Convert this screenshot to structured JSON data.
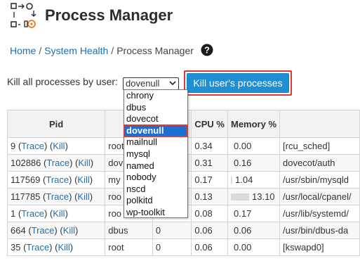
{
  "header": {
    "title": "Process Manager",
    "icon": "process-manager-icon"
  },
  "breadcrumb": {
    "home": "Home",
    "sep": "/",
    "system_health": "System Health",
    "current": "Process Manager",
    "help_icon": "question-circle-icon"
  },
  "kill": {
    "label": "Kill all processes by user:",
    "selected_user": "dovenull",
    "button_label": "Kill user's processes",
    "options": [
      "chrony",
      "dbus",
      "dovecot",
      "dovenull",
      "mailnull",
      "mysql",
      "named",
      "nobody",
      "nscd",
      "polkitd",
      "wp-toolkit"
    ]
  },
  "table": {
    "headers": {
      "pid": "Pid",
      "owner": "O",
      "priority": "ity",
      "cpu": "CPU %",
      "memory": "Memory %",
      "command": ""
    },
    "trace_label": "Trace",
    "kill_label": "Kill",
    "rows": [
      {
        "pid": "9",
        "owner": "root",
        "priority": "",
        "cpu": "0.34",
        "memory": "0.00",
        "mem_fraction": 0.0,
        "command": "[rcu_sched]"
      },
      {
        "pid": "102886",
        "owner": "dov",
        "priority": "",
        "cpu": "0.31",
        "memory": "0.16",
        "mem_fraction": 0.0,
        "command": "dovecot/auth"
      },
      {
        "pid": "117569",
        "owner": "my",
        "priority": "",
        "cpu": "0.17",
        "memory": "1.04",
        "mem_fraction": 0.01,
        "command": "/usr/sbin/mysqld"
      },
      {
        "pid": "117785",
        "owner": "roo",
        "priority": "",
        "cpu": "0.13",
        "memory": "13.10",
        "mem_fraction": 0.131,
        "command": "/usr/local/cpanel/"
      },
      {
        "pid": "1",
        "owner": "roo",
        "priority": "",
        "cpu": "0.08",
        "memory": "0.17",
        "mem_fraction": 0.0,
        "command": "/usr/lib/systemd/"
      },
      {
        "pid": "664",
        "owner": "dbus",
        "priority": "0",
        "cpu": "0.06",
        "memory": "0.06",
        "mem_fraction": 0.0,
        "command": "/usr/bin/dbus-da"
      },
      {
        "pid": "35",
        "owner": "root",
        "priority": "0",
        "cpu": "0.06",
        "memory": "0.00",
        "mem_fraction": 0.0,
        "command": "[kswapd0]"
      }
    ]
  },
  "colors": {
    "accent": "#1f8fd3",
    "highlight": "#d83a3a",
    "link": "#1f6fb2",
    "selected_option": "#1a6fd1"
  }
}
